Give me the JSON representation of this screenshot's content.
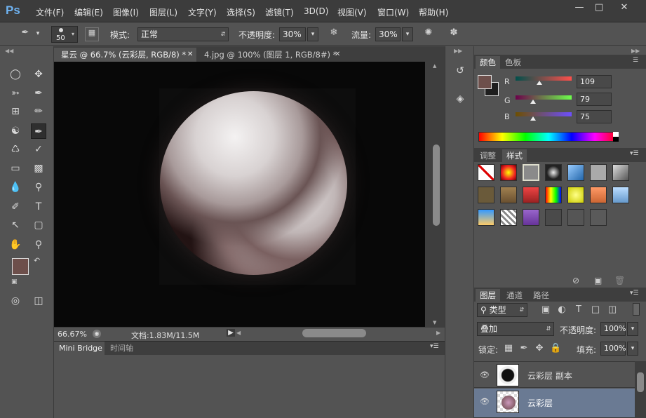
{
  "app": {
    "logo": "Ps"
  },
  "menu": [
    "文件(F)",
    "编辑(E)",
    "图像(I)",
    "图层(L)",
    "文字(Y)",
    "选择(S)",
    "滤镜(T)",
    "3D(D)",
    "视图(V)",
    "窗口(W)",
    "帮助(H)"
  ],
  "options": {
    "brush_size": "50",
    "mode_label": "模式:",
    "mode_value": "正常",
    "opacity_label": "不透明度:",
    "opacity_value": "30%",
    "flow_label": "流量:",
    "flow_value": "30%"
  },
  "doc_tabs": [
    {
      "label": "星云 @ 66.7% (云彩层, RGB/8) *"
    },
    {
      "label": "4.jpg @ 100% (图层 1, RGB/8#) *"
    }
  ],
  "status": {
    "zoom": "66.67%",
    "doc_info": "文档:1.83M/11.5M"
  },
  "bottom_tabs": [
    "Mini Bridge",
    "时间轴"
  ],
  "colors": {
    "foreground": "#6d4f4b",
    "background": "#1e1e1e"
  },
  "color_panel": {
    "tabs": [
      "颜色",
      "色板"
    ],
    "r_label": "R",
    "r_value": "109",
    "g_label": "G",
    "g_value": "79",
    "b_label": "B",
    "b_value": "75"
  },
  "styles_panel": {
    "tabs": [
      "调整",
      "样式"
    ]
  },
  "layers_panel": {
    "tabs": [
      "图层",
      "通道",
      "路径"
    ],
    "filter_label": "类型",
    "blend_mode": "叠加",
    "opacity_label": "不透明度:",
    "opacity_value": "100%",
    "lock_label": "锁定:",
    "fill_label": "填充:",
    "fill_value": "100%",
    "layers": [
      {
        "name": "云彩层 副本"
      },
      {
        "name": "云彩层"
      }
    ]
  }
}
